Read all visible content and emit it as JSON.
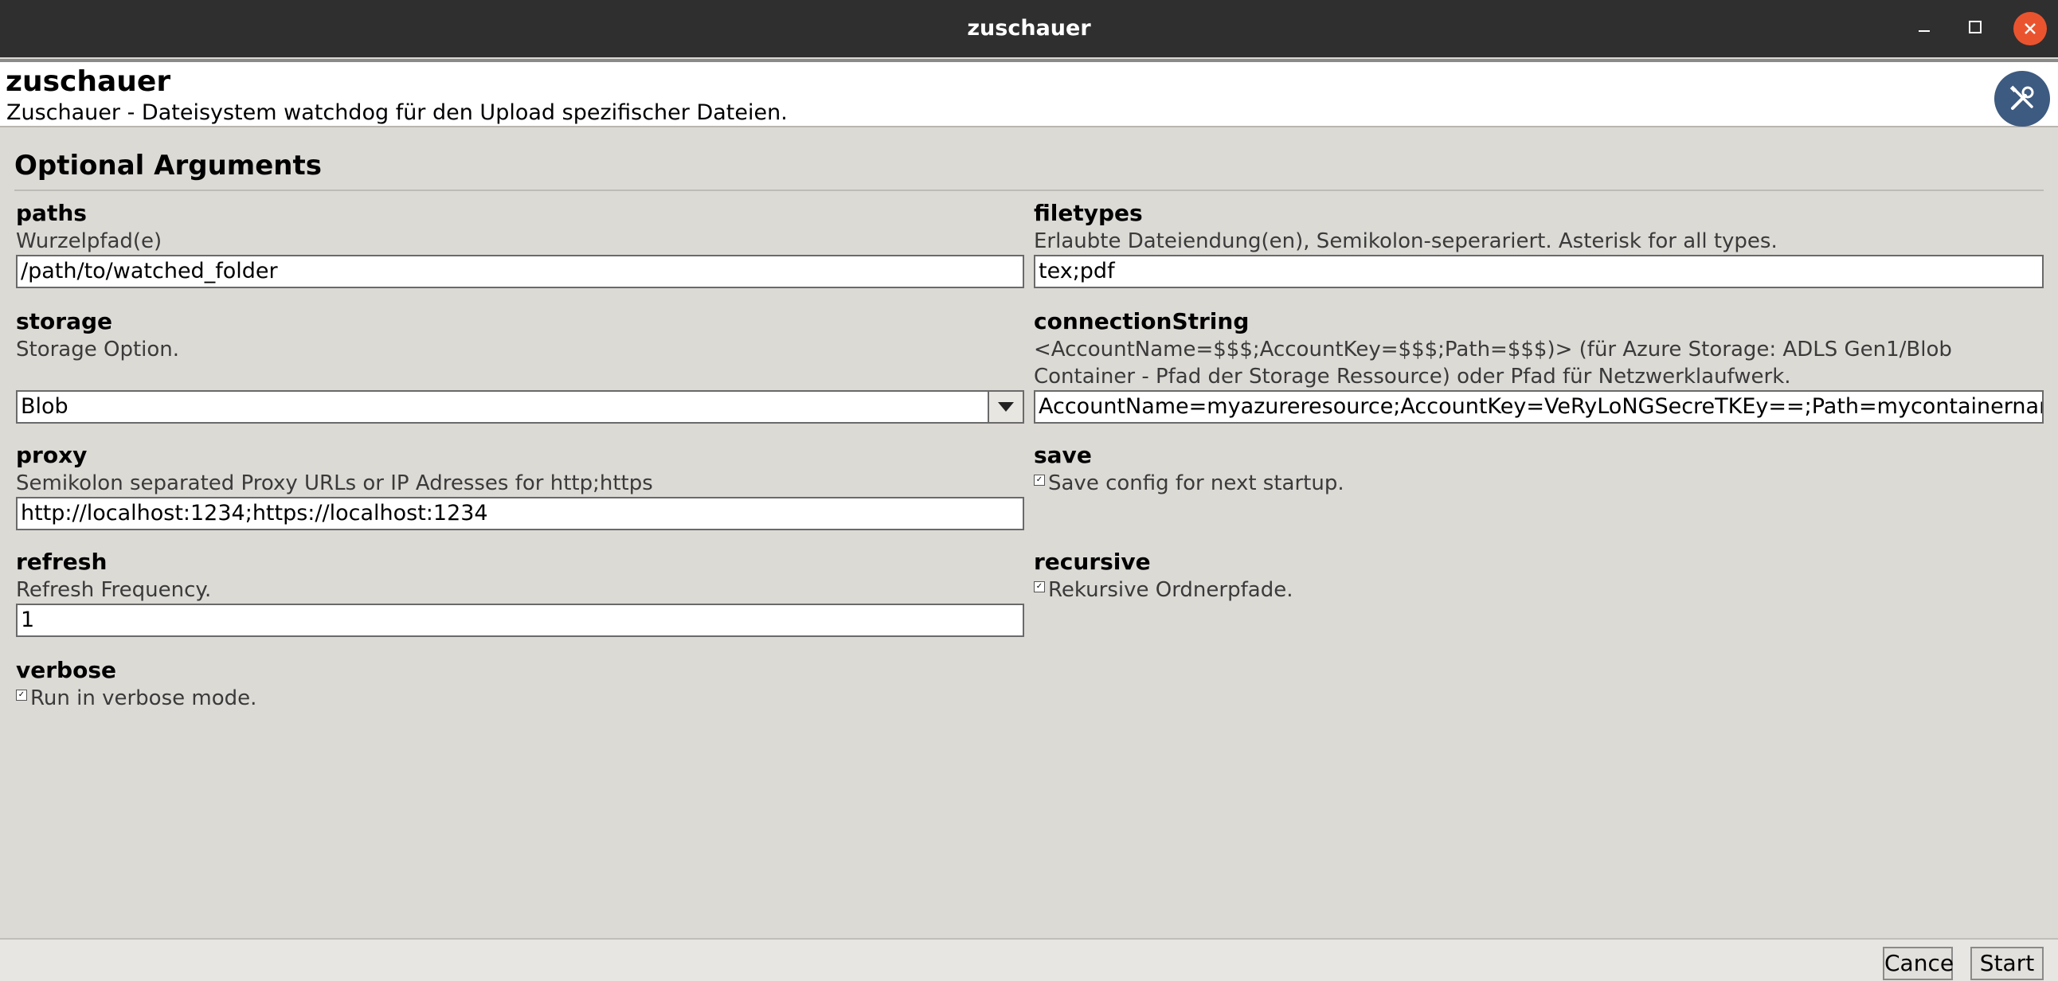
{
  "window": {
    "title": "zuschauer",
    "controls": {
      "minimize": "minimize-icon",
      "maximize": "maximize-icon",
      "close": "close-icon"
    }
  },
  "header": {
    "title": "zuschauer",
    "description": "Zuschauer - Dateisystem watchdog für den Upload spezifischer Dateien.",
    "icon": "wrench-screwdriver-icon"
  },
  "section": {
    "title": "Optional Arguments"
  },
  "fields": {
    "paths": {
      "label": "paths",
      "hint": "Wurzelpfad(e)",
      "value": "/path/to/watched_folder"
    },
    "filetypes": {
      "label": "filetypes",
      "hint": "Erlaubte Dateiendung(en), Semikolon-seperariert. Asterisk for all types.",
      "value": "tex;pdf"
    },
    "storage": {
      "label": "storage",
      "hint": "Storage Option.",
      "value": "Blob"
    },
    "connectionString": {
      "label": "connectionString",
      "hint": "<AccountName=$$$;AccountKey=$$$;Path=$$$)> (für Azure Storage: ADLS Gen1/Blob Container - Pfad der Storage Ressource) oder Pfad für Netzwerklaufwerk.",
      "value": "AccountName=myazureresource;AccountKey=VeRyLoNGSecreTKEy==;Path=mycontainername"
    },
    "proxy": {
      "label": "proxy",
      "hint": "Semikolon separated Proxy URLs or IP Adresses for http;https",
      "value": "http://localhost:1234;https://localhost:1234"
    },
    "save": {
      "label": "save",
      "checkbox_label": "Save config for next startup.",
      "checked": true
    },
    "refresh": {
      "label": "refresh",
      "hint": "Refresh Frequency.",
      "value": "1"
    },
    "recursive": {
      "label": "recursive",
      "checkbox_label": "Rekursive Ordnerpfade.",
      "checked": true
    },
    "verbose": {
      "label": "verbose",
      "checkbox_label": "Run in verbose mode.",
      "checked": true
    }
  },
  "footer": {
    "cancel_label": "Cance",
    "start_label": "Start"
  },
  "colors": {
    "titlebar": "#2f2f2f",
    "close": "#e9542f",
    "background": "#dcdad5",
    "header_icon": "#3d5a80"
  }
}
